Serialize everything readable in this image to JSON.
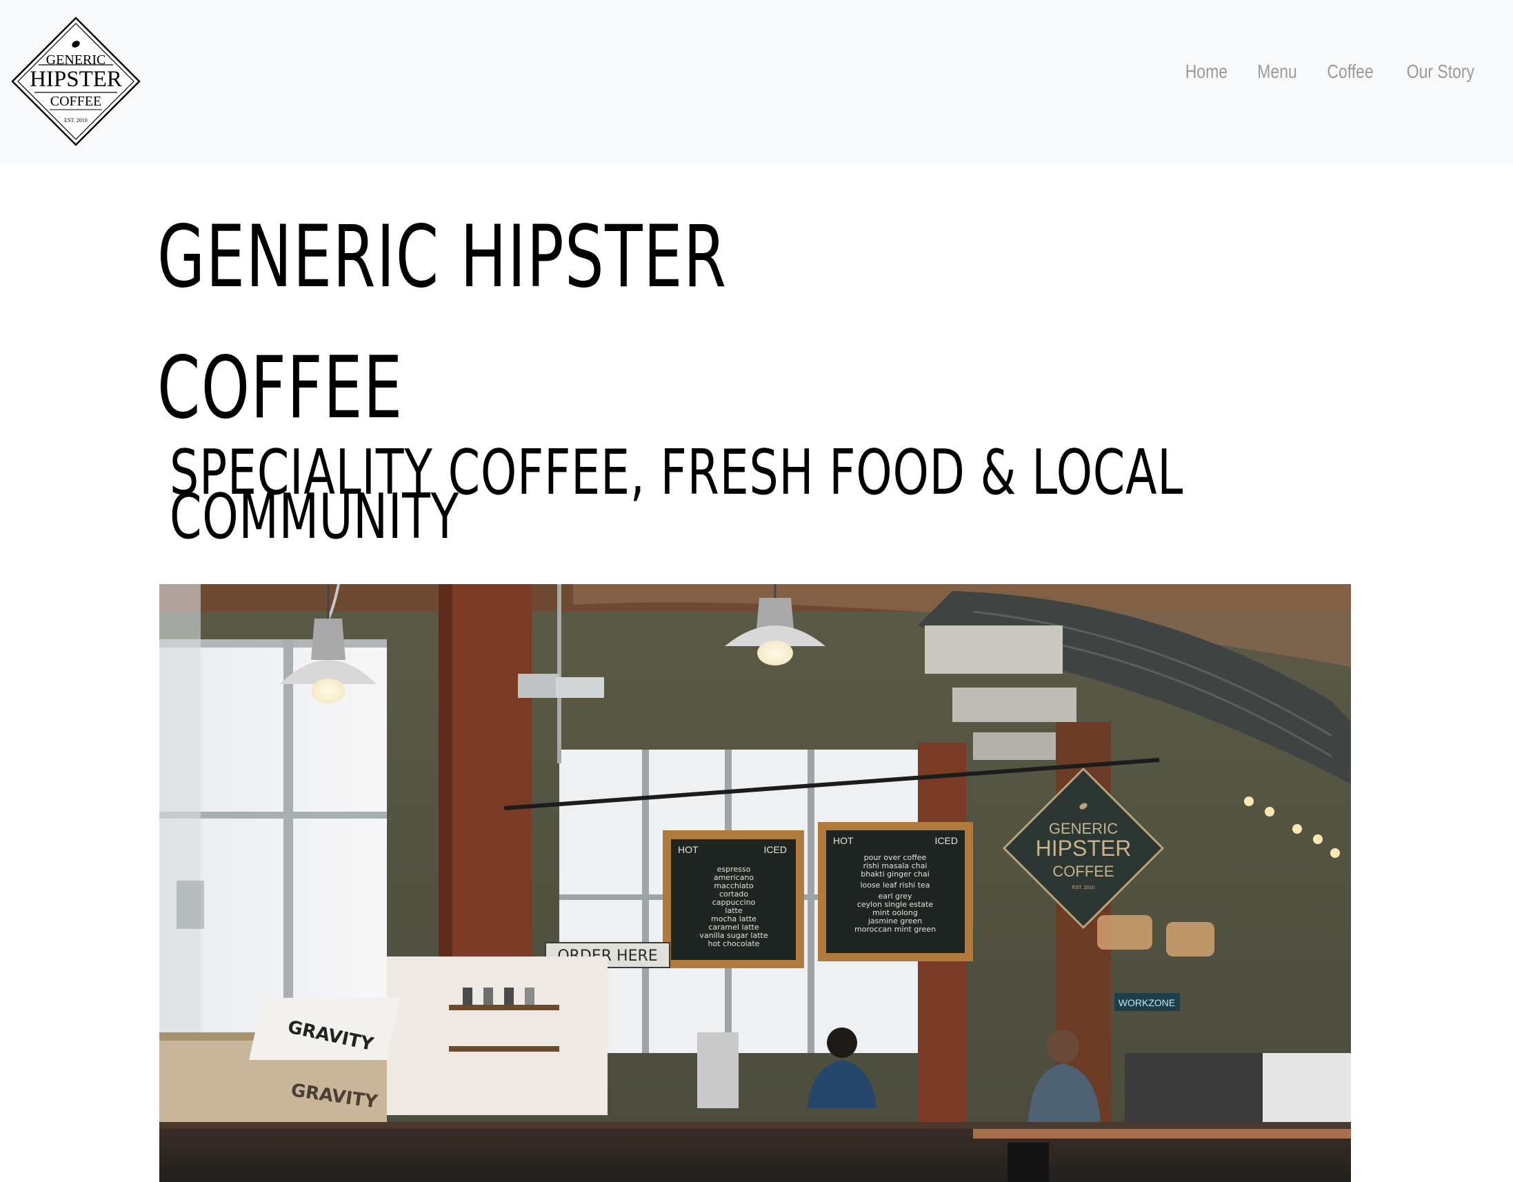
{
  "logo": {
    "line1": "GENERIC",
    "line2": "HIPSTER",
    "line3": "COFFEE",
    "line4": "EST. 2010"
  },
  "nav": {
    "items": [
      "Home",
      "Menu",
      "Coffee",
      "Our Story"
    ]
  },
  "hero": {
    "title_line1": "GENERIC HIPSTER",
    "title_line2": "COFFEE",
    "tagline_line1": "SPECIALITY COFFEE, FRESH FOOD & LOCAL",
    "tagline_line2": "COMMUNITY"
  },
  "photo": {
    "menu_left_hot": "HOT",
    "menu_left_iced": "ICED",
    "menu_left_items": [
      "espresso",
      "americano",
      "macchiato",
      "cortado",
      "cappuccino",
      "latte",
      "mocha latte",
      "caramel latte",
      "vanilla sugar latte",
      "hot chocolate"
    ],
    "menu_right_hot": "HOT",
    "menu_right_iced": "ICED",
    "menu_right_items": [
      "pour over coffee",
      "rishi masala chai",
      "bhakti ginger chai",
      "loose leaf rishi tea",
      "earl grey",
      "ceylon single estate",
      "mint oolong",
      "jasmine green",
      "moroccan mint green"
    ],
    "sign_line1": "GENERIC",
    "sign_line2": "HIPSTER",
    "sign_line3": "COFFEE",
    "sign_est": "EST. 2010",
    "order_here": "ORDER HERE",
    "crate_label": "GRAVITY",
    "magazine_label": "GRAVITY",
    "workzone": "WORKZONE"
  },
  "colors": {
    "navbar_bg": "#f8f9fa",
    "nav_link": "#9a9a9a",
    "text": "#000000"
  }
}
